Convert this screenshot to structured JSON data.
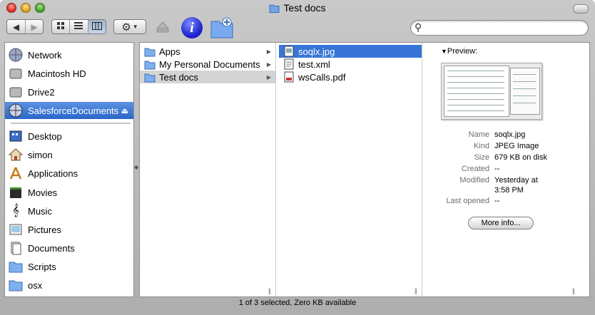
{
  "window": {
    "title": "Test docs"
  },
  "toolbar": {
    "back_icon": "back-arrow-icon",
    "forward_icon": "forward-arrow-icon",
    "view_modes": [
      "icon-view",
      "list-view",
      "column-view"
    ],
    "active_view": "column-view",
    "action_icon": "gear-icon",
    "info_label": "i",
    "search": {
      "placeholder": "",
      "value": ""
    }
  },
  "sidebar": {
    "devices": [
      {
        "label": "Network",
        "icon": "network-globe-icon"
      },
      {
        "label": "Macintosh HD",
        "icon": "hard-disk-icon"
      },
      {
        "label": "Drive2",
        "icon": "hard-disk-icon"
      },
      {
        "label": "SalesforceDocuments",
        "icon": "network-volume-icon",
        "selected": true,
        "ejectable": true
      }
    ],
    "places": [
      {
        "label": "Desktop",
        "icon": "desktop-icon"
      },
      {
        "label": "simon",
        "icon": "home-icon"
      },
      {
        "label": "Applications",
        "icon": "applications-icon"
      },
      {
        "label": "Movies",
        "icon": "movies-icon"
      },
      {
        "label": "Music",
        "icon": "music-icon"
      },
      {
        "label": "Pictures",
        "icon": "pictures-icon"
      },
      {
        "label": "Documents",
        "icon": "documents-icon"
      },
      {
        "label": "Scripts",
        "icon": "folder-icon"
      },
      {
        "label": "osx",
        "icon": "folder-icon"
      }
    ]
  },
  "columns": {
    "col1": [
      {
        "label": "Apps",
        "icon": "folder-icon"
      },
      {
        "label": "My Personal Documents",
        "icon": "folder-icon"
      },
      {
        "label": "Test docs",
        "icon": "folder-icon",
        "selected": true
      }
    ],
    "col2": [
      {
        "label": "soqlx.jpg",
        "icon": "jpeg-file-icon",
        "selected": true
      },
      {
        "label": "test.xml",
        "icon": "xml-file-icon"
      },
      {
        "label": "wsCalls.pdf",
        "icon": "pdf-file-icon"
      }
    ]
  },
  "preview": {
    "heading": "Preview:",
    "labels": {
      "name": "Name",
      "kind": "Kind",
      "size": "Size",
      "created": "Created",
      "modified": "Modified",
      "last_opened": "Last opened"
    },
    "values": {
      "name": "soqlx.jpg",
      "kind": "JPEG Image",
      "size": "679 KB on disk",
      "created": "--",
      "modified_1": "Yesterday at",
      "modified_2": "3:58 PM",
      "last_opened": "--"
    },
    "more_info": "More info..."
  },
  "status": {
    "text": "1 of 3 selected, Zero KB available"
  },
  "colors": {
    "selection_blue": "#3875d7",
    "sidebar_selection": "#2a66c9",
    "info_blue": "#1c21c9"
  }
}
